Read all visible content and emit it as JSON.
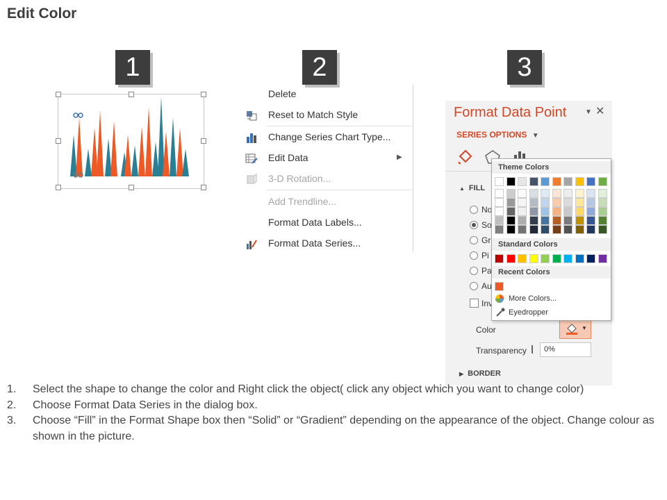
{
  "page_title": "Edit Color",
  "steps": [
    "1",
    "2",
    "3"
  ],
  "context_menu": {
    "items": [
      {
        "label": "Delete",
        "icon": "none",
        "disabled": false
      },
      {
        "label": "Reset to Match Style",
        "icon": "reset-style-icon",
        "disabled": false
      },
      {
        "label": "Change Series Chart Type...",
        "icon": "bar-chart-icon",
        "disabled": false
      },
      {
        "label": "Edit Data",
        "icon": "edit-data-icon",
        "disabled": false,
        "submenu": true
      },
      {
        "label": "3-D Rotation...",
        "icon": "rotation-icon",
        "disabled": true
      },
      {
        "label": "Add Trendline...",
        "icon": "none",
        "disabled": true
      },
      {
        "label": "Format Data Labels...",
        "icon": "none",
        "disabled": false
      },
      {
        "label": "Format Data Series...",
        "icon": "format-series-icon",
        "disabled": false
      }
    ]
  },
  "format_pane": {
    "title": "Format Data Point",
    "series_options": "SERIES OPTIONS",
    "fill_section": "FILL",
    "fill_options": [
      "No",
      "So",
      "Gr",
      "Pi",
      "Pa",
      "Au"
    ],
    "selected_fill": "So",
    "invert_label": "Inv",
    "color_label": "Color",
    "transparency_label": "Transparency",
    "transparency_value": "0%",
    "border_section": "BORDER"
  },
  "color_popup": {
    "theme_header": "Theme Colors",
    "standard_header": "Standard Colors",
    "recent_header": "Recent Colors",
    "more_colors": "More Colors...",
    "eyedropper": "Eyedropper",
    "theme_colors": [
      "#ffffff",
      "#000000",
      "#e7e6e6",
      "#44546a",
      "#5b9bd5",
      "#ed7d31",
      "#a5a5a5",
      "#ffc000",
      "#4472c4",
      "#70ad47"
    ],
    "standard_colors": [
      "#c00000",
      "#ff0000",
      "#ffc000",
      "#ffff00",
      "#92d050",
      "#00b050",
      "#00b0f0",
      "#0070c0",
      "#002060",
      "#7030a0"
    ],
    "recent_colors": [
      "#ed5a26"
    ],
    "accent_color": "#d24726"
  },
  "instructions": [
    {
      "num": "1.",
      "text": "Select the shape to change the color and Right click the object( click any object which you want to change color)"
    },
    {
      "num": "2.",
      "text": "Choose Format Data Series in the dialog box."
    },
    {
      "num": "3.",
      "text": "Choose “Fill” in the Format Shape box then “Solid” or “Gradient” depending on the appearance of the object. Change colour as shown in the picture."
    }
  ],
  "chart_colors": {
    "orange": "#ed5a26",
    "teal": "#2a7f94"
  }
}
